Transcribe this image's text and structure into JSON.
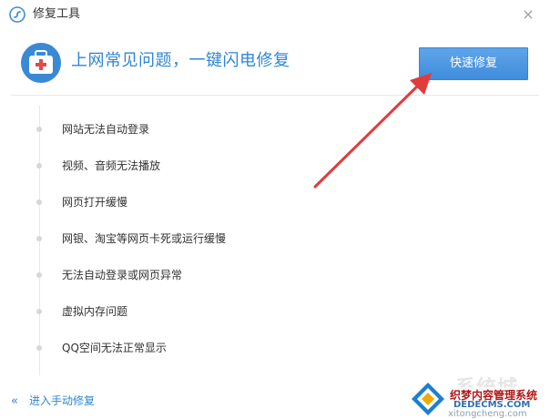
{
  "window": {
    "title": "修复工具",
    "close_glyph": "×"
  },
  "header": {
    "headline": "上网常见问题，一键闪电修复",
    "quick_fix_label": "快速修复"
  },
  "issues": [
    {
      "label": "网站无法自动登录"
    },
    {
      "label": "视频、音频无法播放"
    },
    {
      "label": "网页打开缓慢"
    },
    {
      "label": "网银、淘宝等网页卡死或运行缓慢"
    },
    {
      "label": "无法自动登录或网页异常"
    },
    {
      "label": "虚拟内存问题"
    },
    {
      "label": "QQ空间无法正常显示"
    }
  ],
  "footer": {
    "chevron": "«",
    "manual_fix_label": "进入手动修复"
  },
  "watermark": {
    "main": "系统城",
    "red_text": "织梦内容管理系统",
    "site": "DEDECMS.COM",
    "url": "xitongcheng.com"
  },
  "colors": {
    "accent": "#2f86d6",
    "button": "#4a95e2",
    "arrow": "#e23b3b"
  },
  "icons": {
    "app": "app-logo-icon",
    "toolbox": "first-aid-kit-icon",
    "close": "close-icon",
    "chevron": "double-chevron-left-icon"
  }
}
